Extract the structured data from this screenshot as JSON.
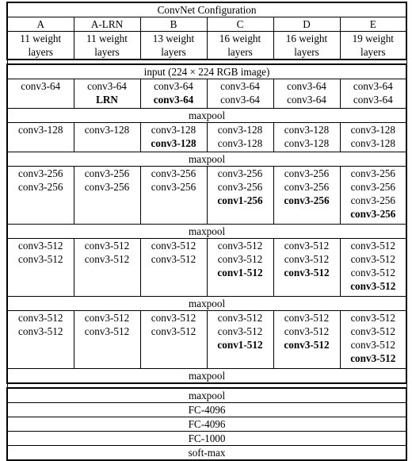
{
  "table": {
    "title": "ConvNet Configuration",
    "columns": [
      {
        "name": "A",
        "weights": [
          "11 weight",
          "layers"
        ]
      },
      {
        "name": "A-LRN",
        "weights": [
          "11 weight",
          "layers"
        ]
      },
      {
        "name": "B",
        "weights": [
          "13 weight",
          "layers"
        ]
      },
      {
        "name": "C",
        "weights": [
          "16 weight",
          "layers"
        ]
      },
      {
        "name": "D",
        "weights": [
          "16 weight",
          "layers"
        ]
      },
      {
        "name": "E",
        "weights": [
          "19 weight",
          "layers"
        ]
      }
    ],
    "input_row": "input (224 × 224 RGB image)",
    "maxpool": "maxpool",
    "blocks": [
      {
        "id": "block-64",
        "cells": [
          [
            {
              "t": "conv3-64",
              "b": false
            }
          ],
          [
            {
              "t": "conv3-64",
              "b": false
            },
            {
              "t": "LRN",
              "b": true
            }
          ],
          [
            {
              "t": "conv3-64",
              "b": false
            },
            {
              "t": "conv3-64",
              "b": true
            }
          ],
          [
            {
              "t": "conv3-64",
              "b": false
            },
            {
              "t": "conv3-64",
              "b": false
            }
          ],
          [
            {
              "t": "conv3-64",
              "b": false
            },
            {
              "t": "conv3-64",
              "b": false
            }
          ],
          [
            {
              "t": "conv3-64",
              "b": false
            },
            {
              "t": "conv3-64",
              "b": false
            }
          ]
        ]
      },
      {
        "id": "block-128",
        "cells": [
          [
            {
              "t": "conv3-128",
              "b": false
            }
          ],
          [
            {
              "t": "conv3-128",
              "b": false
            }
          ],
          [
            {
              "t": "conv3-128",
              "b": false
            },
            {
              "t": "conv3-128",
              "b": true
            }
          ],
          [
            {
              "t": "conv3-128",
              "b": false
            },
            {
              "t": "conv3-128",
              "b": false
            }
          ],
          [
            {
              "t": "conv3-128",
              "b": false
            },
            {
              "t": "conv3-128",
              "b": false
            }
          ],
          [
            {
              "t": "conv3-128",
              "b": false
            },
            {
              "t": "conv3-128",
              "b": false
            }
          ]
        ]
      },
      {
        "id": "block-256",
        "cells": [
          [
            {
              "t": "conv3-256",
              "b": false
            },
            {
              "t": "conv3-256",
              "b": false
            }
          ],
          [
            {
              "t": "conv3-256",
              "b": false
            },
            {
              "t": "conv3-256",
              "b": false
            }
          ],
          [
            {
              "t": "conv3-256",
              "b": false
            },
            {
              "t": "conv3-256",
              "b": false
            }
          ],
          [
            {
              "t": "conv3-256",
              "b": false
            },
            {
              "t": "conv3-256",
              "b": false
            },
            {
              "t": "conv1-256",
              "b": true
            }
          ],
          [
            {
              "t": "conv3-256",
              "b": false
            },
            {
              "t": "conv3-256",
              "b": false
            },
            {
              "t": "conv3-256",
              "b": true
            }
          ],
          [
            {
              "t": "conv3-256",
              "b": false
            },
            {
              "t": "conv3-256",
              "b": false
            },
            {
              "t": "conv3-256",
              "b": false
            },
            {
              "t": "conv3-256",
              "b": true
            }
          ]
        ]
      },
      {
        "id": "block-512a",
        "cells": [
          [
            {
              "t": "conv3-512",
              "b": false
            },
            {
              "t": "conv3-512",
              "b": false
            }
          ],
          [
            {
              "t": "conv3-512",
              "b": false
            },
            {
              "t": "conv3-512",
              "b": false
            }
          ],
          [
            {
              "t": "conv3-512",
              "b": false
            },
            {
              "t": "conv3-512",
              "b": false
            }
          ],
          [
            {
              "t": "conv3-512",
              "b": false
            },
            {
              "t": "conv3-512",
              "b": false
            },
            {
              "t": "conv1-512",
              "b": true
            }
          ],
          [
            {
              "t": "conv3-512",
              "b": false
            },
            {
              "t": "conv3-512",
              "b": false
            },
            {
              "t": "conv3-512",
              "b": true
            }
          ],
          [
            {
              "t": "conv3-512",
              "b": false
            },
            {
              "t": "conv3-512",
              "b": false
            },
            {
              "t": "conv3-512",
              "b": false
            },
            {
              "t": "conv3-512",
              "b": true
            }
          ]
        ]
      },
      {
        "id": "block-512b",
        "cells": [
          [
            {
              "t": "conv3-512",
              "b": false
            },
            {
              "t": "conv3-512",
              "b": false
            }
          ],
          [
            {
              "t": "conv3-512",
              "b": false
            },
            {
              "t": "conv3-512",
              "b": false
            }
          ],
          [
            {
              "t": "conv3-512",
              "b": false
            },
            {
              "t": "conv3-512",
              "b": false
            }
          ],
          [
            {
              "t": "conv3-512",
              "b": false
            },
            {
              "t": "conv3-512",
              "b": false
            },
            {
              "t": "conv1-512",
              "b": true
            }
          ],
          [
            {
              "t": "conv3-512",
              "b": false
            },
            {
              "t": "conv3-512",
              "b": false
            },
            {
              "t": "conv3-512",
              "b": true
            }
          ],
          [
            {
              "t": "conv3-512",
              "b": false
            },
            {
              "t": "conv3-512",
              "b": false
            },
            {
              "t": "conv3-512",
              "b": false
            },
            {
              "t": "conv3-512",
              "b": true
            }
          ]
        ]
      }
    ],
    "tail_rows": [
      "maxpool",
      "FC-4096",
      "FC-4096",
      "FC-1000",
      "soft-max"
    ]
  }
}
